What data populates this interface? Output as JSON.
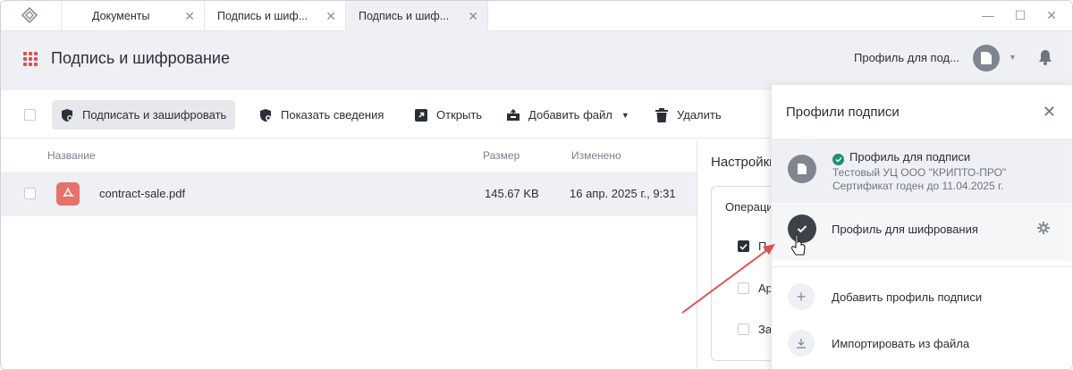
{
  "tabs": [
    {
      "label": "Документы",
      "active": false
    },
    {
      "label": "Подпись и шиф...",
      "active": false
    },
    {
      "label": "Подпись и шиф...",
      "active": true
    }
  ],
  "window_controls": {
    "minimize": "—",
    "maximize": "☐",
    "close": "✕"
  },
  "header": {
    "title": "Подпись и шифрование",
    "profile_label": "Профиль для под...",
    "accent_color": "#d9534f"
  },
  "toolbar": {
    "sign_encrypt": "Подписать и зашифровать",
    "show_info": "Показать сведения",
    "open": "Открыть",
    "add_file": "Добавить файл",
    "delete": "Удалить"
  },
  "table": {
    "columns": {
      "name": "Название",
      "size": "Размер",
      "modified": "Изменено"
    },
    "rows": [
      {
        "name": "contract-sale.pdf",
        "size": "145.67 KB",
        "modified": "16 апр. 2025 г., 9:31",
        "icon": "pdf-icon"
      }
    ]
  },
  "settings": {
    "title": "Настройки",
    "group": "Операции",
    "options": [
      "П",
      "Ар",
      "За"
    ]
  },
  "profiles_panel": {
    "title": "Профили подписи",
    "close": "✕",
    "profiles": [
      {
        "name": "Профиль для подписи",
        "issuer": "Тестовый УЦ ООО \"КРИПТО-ПРО\"",
        "validity": "Сертификат годен до 11.04.2025 г.",
        "status_color": "#1e8f72"
      },
      {
        "name": "Профиль для шифрования"
      }
    ],
    "actions": [
      {
        "label": "Добавить профиль подписи",
        "icon": "plus-icon"
      },
      {
        "label": "Импортировать из файла",
        "icon": "download-icon"
      }
    ]
  },
  "annotation": {
    "arrow_color": "#e0504a"
  }
}
